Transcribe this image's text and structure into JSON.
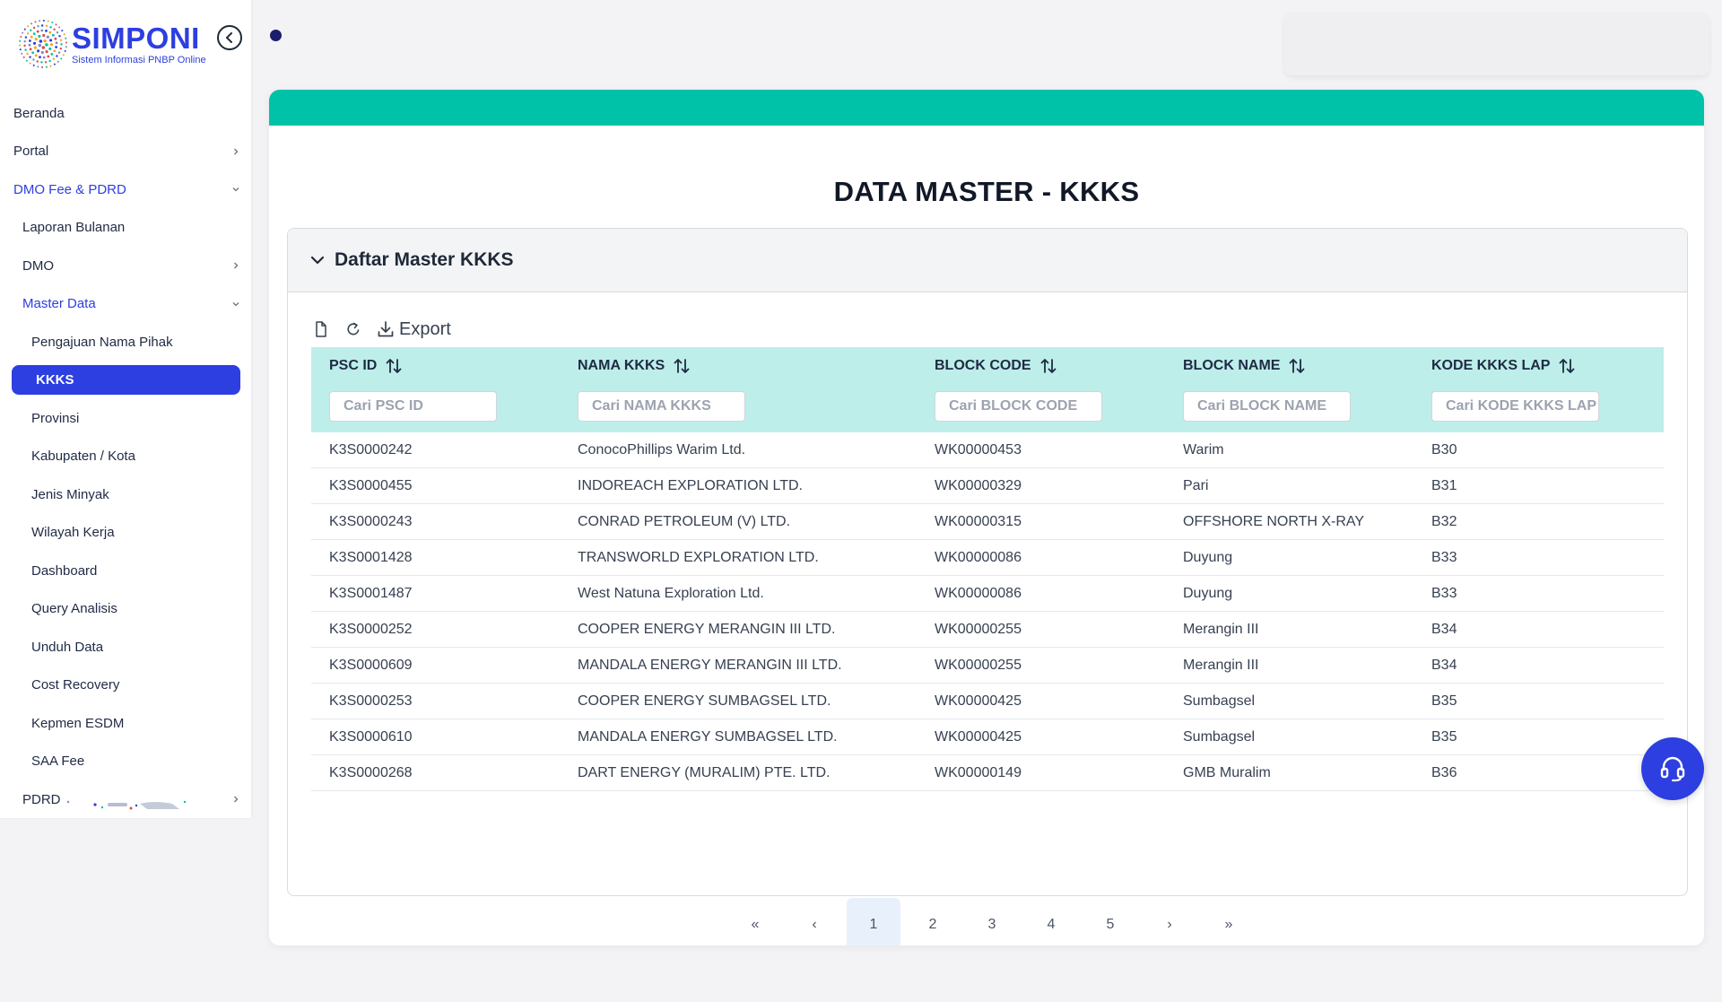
{
  "app": {
    "logo_title": "SIMPONI",
    "logo_subtitle": "Sistem Informasi PNBP Online",
    "brand_color": "#2d3fe0",
    "accent_color": "#00c2a8"
  },
  "sidebar": {
    "items": [
      {
        "label": "Beranda"
      },
      {
        "label": "Portal"
      },
      {
        "label": "DMO Fee & PDRD"
      },
      {
        "label": "Laporan Bulanan"
      },
      {
        "label": "DMO"
      },
      {
        "label": "Master Data"
      },
      {
        "label": "Pengajuan Nama Pihak"
      },
      {
        "label": "KKKS"
      },
      {
        "label": "Provinsi"
      },
      {
        "label": "Kabupaten / Kota"
      },
      {
        "label": "Jenis Minyak"
      },
      {
        "label": "Wilayah Kerja"
      },
      {
        "label": "Dashboard"
      },
      {
        "label": "Query Analisis"
      },
      {
        "label": "Unduh Data"
      },
      {
        "label": "Cost Recovery"
      },
      {
        "label": "Kepmen ESDM"
      },
      {
        "label": "SAA Fee"
      },
      {
        "label": "PDRD"
      }
    ]
  },
  "page": {
    "title": "DATA MASTER - KKKS",
    "panel_title": "Daftar Master KKKS",
    "export_label": "Export"
  },
  "table": {
    "columns": [
      {
        "label": "PSC ID",
        "placeholder": "Cari PSC ID"
      },
      {
        "label": "NAMA KKKS",
        "placeholder": "Cari NAMA KKKS"
      },
      {
        "label": "BLOCK CODE",
        "placeholder": "Cari BLOCK CODE"
      },
      {
        "label": "BLOCK NAME",
        "placeholder": "Cari BLOCK NAME"
      },
      {
        "label": "KODE KKKS LAP",
        "placeholder": "Cari KODE KKKS LAP"
      }
    ],
    "rows": [
      [
        "K3S0000242",
        "ConocoPhillips Warim Ltd.",
        "WK00000453",
        "Warim",
        "B30"
      ],
      [
        "K3S0000455",
        "INDOREACH EXPLORATION LTD.",
        "WK00000329",
        "Pari",
        "B31"
      ],
      [
        "K3S0000243",
        "CONRAD PETROLEUM (V) LTD.",
        "WK00000315",
        "OFFSHORE NORTH X-RAY",
        "B32"
      ],
      [
        "K3S0001428",
        "TRANSWORLD EXPLORATION LTD.",
        "WK00000086",
        "Duyung",
        "B33"
      ],
      [
        "K3S0001487",
        "West Natuna Exploration Ltd.",
        "WK00000086",
        "Duyung",
        "B33"
      ],
      [
        "K3S0000252",
        "COOPER ENERGY MERANGIN III LTD.",
        "WK00000255",
        "Merangin III",
        "B34"
      ],
      [
        "K3S0000609",
        "MANDALA ENERGY MERANGIN III LTD.",
        "WK00000255",
        "Merangin III",
        "B34"
      ],
      [
        "K3S0000253",
        "COOPER ENERGY SUMBAGSEL LTD.",
        "WK00000425",
        "Sumbagsel",
        "B35"
      ],
      [
        "K3S0000610",
        "MANDALA ENERGY SUMBAGSEL LTD.",
        "WK00000425",
        "Sumbagsel",
        "B35"
      ],
      [
        "K3S0000268",
        "DART ENERGY (MURALIM) PTE. LTD.",
        "WK00000149",
        "GMB Muralim",
        "B36"
      ]
    ]
  },
  "pagination": {
    "first": "«",
    "prev": "‹",
    "pages": [
      "1",
      "2",
      "3",
      "4",
      "5"
    ],
    "current": "1",
    "next": "›",
    "last": "»"
  }
}
